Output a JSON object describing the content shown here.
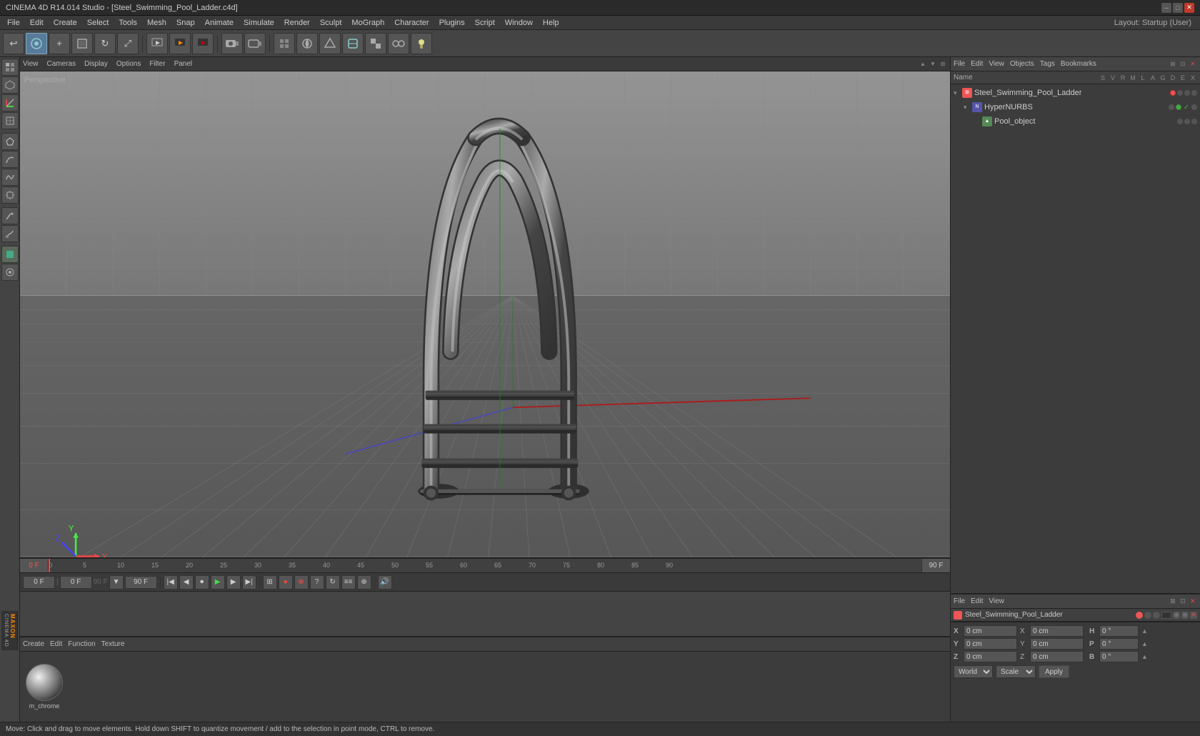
{
  "titlebar": {
    "title": "CINEMA 4D R14.014 Studio - [Steel_Swimming_Pool_Ladder.c4d]",
    "min": "─",
    "max": "□",
    "close": "✕"
  },
  "menubar": {
    "items": [
      "File",
      "Edit",
      "Create",
      "Select",
      "Tools",
      "Mesh",
      "Snap",
      "Animate",
      "Simulate",
      "Render",
      "Sculpt",
      "MoGraph",
      "Character",
      "Plugins",
      "Script",
      "Window",
      "Help"
    ],
    "layout_label": "Layout: Startup (User)"
  },
  "viewport": {
    "menus": [
      "View",
      "Cameras",
      "Display",
      "Options",
      "Filter",
      "Panel"
    ],
    "perspective_label": "Perspective"
  },
  "object_manager": {
    "top_menus": [
      "File",
      "Edit",
      "View",
      "Objects",
      "Tags",
      "Bookmarks"
    ],
    "columns": {
      "name": "Name",
      "letters": [
        "S",
        "V",
        "R",
        "M",
        "L",
        "A",
        "G",
        "D",
        "E",
        "X"
      ]
    },
    "objects": [
      {
        "indent": 0,
        "expand": "▾",
        "icon_color": "#e55",
        "label": "Steel_Swimming_Pool_Ladder",
        "dots": [
          "pink",
          "gray",
          "gray",
          "gray",
          "gray",
          "gray",
          "gray",
          "gray",
          "gray",
          "gray"
        ]
      },
      {
        "indent": 1,
        "expand": "▾",
        "icon_color": "#55e",
        "label": "HyperNURBS",
        "dots": [
          "gray",
          "green",
          "gray",
          "gray",
          "gray",
          "gray",
          "gray",
          "gray",
          "gray",
          "gray"
        ]
      },
      {
        "indent": 2,
        "expand": "",
        "icon_color": "#5a5",
        "label": "Pool_object",
        "dots": [
          "gray",
          "gray",
          "gray",
          "gray",
          "gray",
          "gray",
          "gray",
          "gray",
          "gray",
          "gray"
        ]
      }
    ]
  },
  "attr_panel": {
    "top_menus": [
      "File",
      "Edit",
      "View"
    ],
    "bottom_obj_label": "Steel_Swimming_Pool_Ladder",
    "coords": {
      "x_pos": "0 cm",
      "y_pos": "0 cm",
      "z_pos": "0 cm",
      "x_rot": "0 cm",
      "y_rot": "0 cm",
      "z_rot": "0 cm",
      "h_val": "0 °",
      "p_val": "0 °",
      "b_val": "0 °"
    },
    "transform_space": "World",
    "transform_type": "Scale",
    "apply_btn": "Apply"
  },
  "timeline": {
    "start_frame": "0 F",
    "current_frame": "0 F",
    "end_frame": "90 F",
    "end_frame2": "90 F",
    "frame_indicator": "0 F",
    "ticks": [
      "0",
      "5",
      "10",
      "15",
      "20",
      "25",
      "30",
      "35",
      "40",
      "45",
      "50",
      "55",
      "60",
      "65",
      "70",
      "75",
      "80",
      "85",
      "90"
    ]
  },
  "materials": {
    "top_menus": [
      "Create",
      "Edit",
      "Function",
      "Texture"
    ],
    "items": [
      {
        "label": "m_chrome",
        "type": "chrome"
      }
    ]
  },
  "statusbar": {
    "text": "Move: Click and drag to move elements. Hold down SHIFT to quantize movement / add to the selection in point mode, CTRL to remove."
  },
  "icons": {
    "undo": "↩",
    "redo": "↪",
    "new_obj": "+",
    "move": "⊕",
    "rotate": "↻",
    "scale": "⤢",
    "render": "▶",
    "play": "▶",
    "stop": "■",
    "prev": "◀◀",
    "next": "▶▶",
    "first": "|◀",
    "last": "▶|",
    "record": "●"
  }
}
